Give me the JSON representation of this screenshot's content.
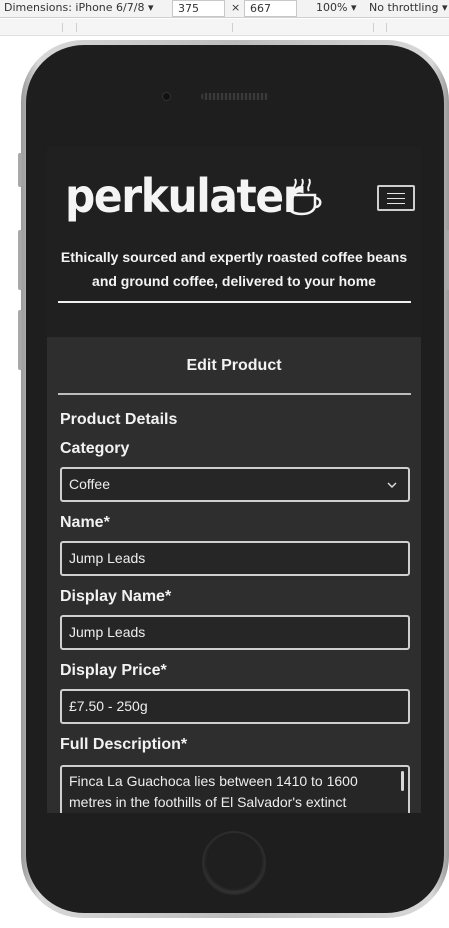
{
  "devtools": {
    "dimensions_label": "Dimensions: iPhone 6/7/8",
    "width": "375",
    "times": "×",
    "height": "667",
    "zoom": "100%",
    "throttling": "No throttling"
  },
  "site": {
    "logo": "perkulater",
    "tagline": "Ethically sourced and expertly roasted coffee beans and ground coffee, delivered to your home"
  },
  "form": {
    "page_title": "Edit Product",
    "section_title": "Product Details",
    "category_label": "Category",
    "category_value": "Coffee",
    "name_label": "Name*",
    "name_value": "Jump Leads",
    "display_name_label": "Display Name*",
    "display_name_value": "Jump Leads",
    "display_price_label": "Display Price*",
    "display_price_value": "£7.50 - 250g",
    "full_description_label": "Full Description*",
    "full_description_value": "Finca La Guachoca lies between 1410 to 1600 metres in the foothills of El Salvador's extinct"
  },
  "icons": {
    "logo_icon": "coffee-cup-icon",
    "menu_icon": "hamburger-menu-icon",
    "select_icon": "chevron-down-icon"
  },
  "colors": {
    "header_bg": "#202020",
    "content_bg": "#2e2e2e",
    "text": "#f2f2f2"
  }
}
